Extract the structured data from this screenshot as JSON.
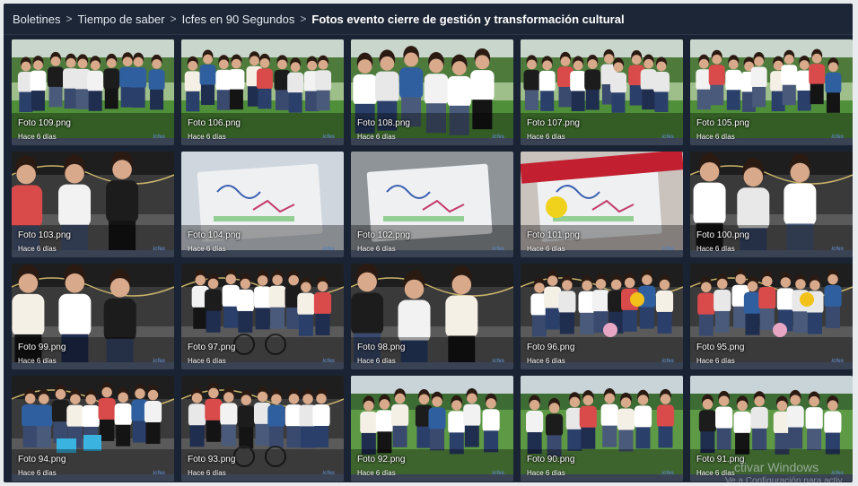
{
  "breadcrumb": [
    {
      "label": "Boletines"
    },
    {
      "label": "Tiempo de saber"
    },
    {
      "label": "Icfes en 90 Segundos"
    },
    {
      "label": "Fotos evento cierre de gestión y transformación cultural"
    }
  ],
  "photos": [
    {
      "name": "Foto 109.png",
      "date": "Hace 6 días",
      "scene": "group-outdoor"
    },
    {
      "name": "Foto 106.png",
      "date": "Hace 6 días",
      "scene": "group-outdoor"
    },
    {
      "name": "Foto 108.png",
      "date": "Hace 6 días",
      "scene": "group-outdoor-close"
    },
    {
      "name": "Foto 107.png",
      "date": "Hace 6 días",
      "scene": "group-outdoor"
    },
    {
      "name": "Foto 105.png",
      "date": "Hace 6 días",
      "scene": "group-outdoor"
    },
    {
      "name": "Foto 103.png",
      "date": "Hace 6 días",
      "scene": "tent-people"
    },
    {
      "name": "Foto 104.png",
      "date": "Hace 6 días",
      "scene": "drawing-paper"
    },
    {
      "name": "Foto 102.png",
      "date": "Hace 6 días",
      "scene": "drawing-paper-gray"
    },
    {
      "name": "Foto 101.png",
      "date": "Hace 6 días",
      "scene": "drawing-paper-red"
    },
    {
      "name": "Foto 100.png",
      "date": "Hace 6 días",
      "scene": "tent-women"
    },
    {
      "name": "Foto 99.png",
      "date": "Hace 6 días",
      "scene": "tent-people"
    },
    {
      "name": "Foto 97.png",
      "date": "Hace 6 días",
      "scene": "tent-group-bike"
    },
    {
      "name": "Foto 98.png",
      "date": "Hace 6 días",
      "scene": "tent-men"
    },
    {
      "name": "Foto 96.png",
      "date": "Hace 6 días",
      "scene": "tent-group-balloons"
    },
    {
      "name": "Foto 95.png",
      "date": "Hace 6 días",
      "scene": "tent-group-balloons"
    },
    {
      "name": "Foto 94.png",
      "date": "Hace 6 días",
      "scene": "tent-group-gifts"
    },
    {
      "name": "Foto 93.png",
      "date": "Hace 6 días",
      "scene": "tent-group-bike"
    },
    {
      "name": "Foto 92.png",
      "date": "Hace 6 días",
      "scene": "field-group"
    },
    {
      "name": "Foto 90.png",
      "date": "Hace 6 días",
      "scene": "field-group"
    },
    {
      "name": "Foto 91.png",
      "date": "Hace 6 días",
      "scene": "field-group"
    }
  ],
  "tile_brand": "icfes",
  "watermark": {
    "line1": "ctivar Windows",
    "line2": "Ve a Configuración para activ"
  },
  "colors": {
    "background": "#1a2333",
    "tile": "#2b3445",
    "text": "#ffffff"
  }
}
